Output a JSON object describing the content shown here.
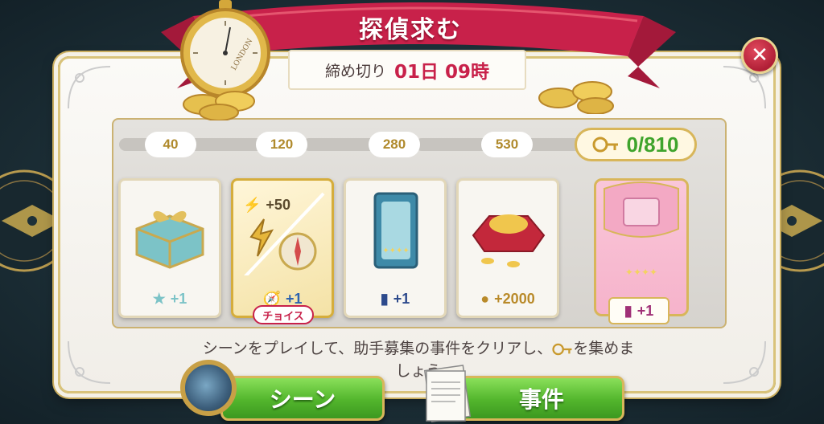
{
  "header": {
    "title": "探偵求む",
    "deadline_label": "締め切り",
    "deadline_value": "01日 09時",
    "watch_text": "LONDON"
  },
  "progress": {
    "milestones": [
      "40",
      "120",
      "280",
      "530"
    ],
    "key_count": "0/810"
  },
  "rewards": [
    {
      "name": "gift-box",
      "amount": "+1",
      "color": "#7cc3c7"
    },
    {
      "name": "energy-or-compass",
      "amount_top": "+50",
      "amount": "+1",
      "choice_label": "チョイス",
      "color": "#2d63b0"
    },
    {
      "name": "blue-card",
      "amount": "+1",
      "color": "#2d4a8c"
    },
    {
      "name": "coins-pouch",
      "amount": "+2000",
      "color": "#b98a2a"
    }
  ],
  "grand_reward": {
    "amount": "+1"
  },
  "instruction": {
    "text_before_icon": "シーンをプレイして、助手募集の事件をクリアし、",
    "text_after_icon": "を集めま",
    "text_line2": "しょう"
  },
  "buttons": {
    "scene": "シーン",
    "case": "事件"
  },
  "colors": {
    "ribbon": "#c8214a",
    "accent_gold": "#d8b65a",
    "button_green": "#52b52c",
    "key_green": "#3fa42c"
  }
}
